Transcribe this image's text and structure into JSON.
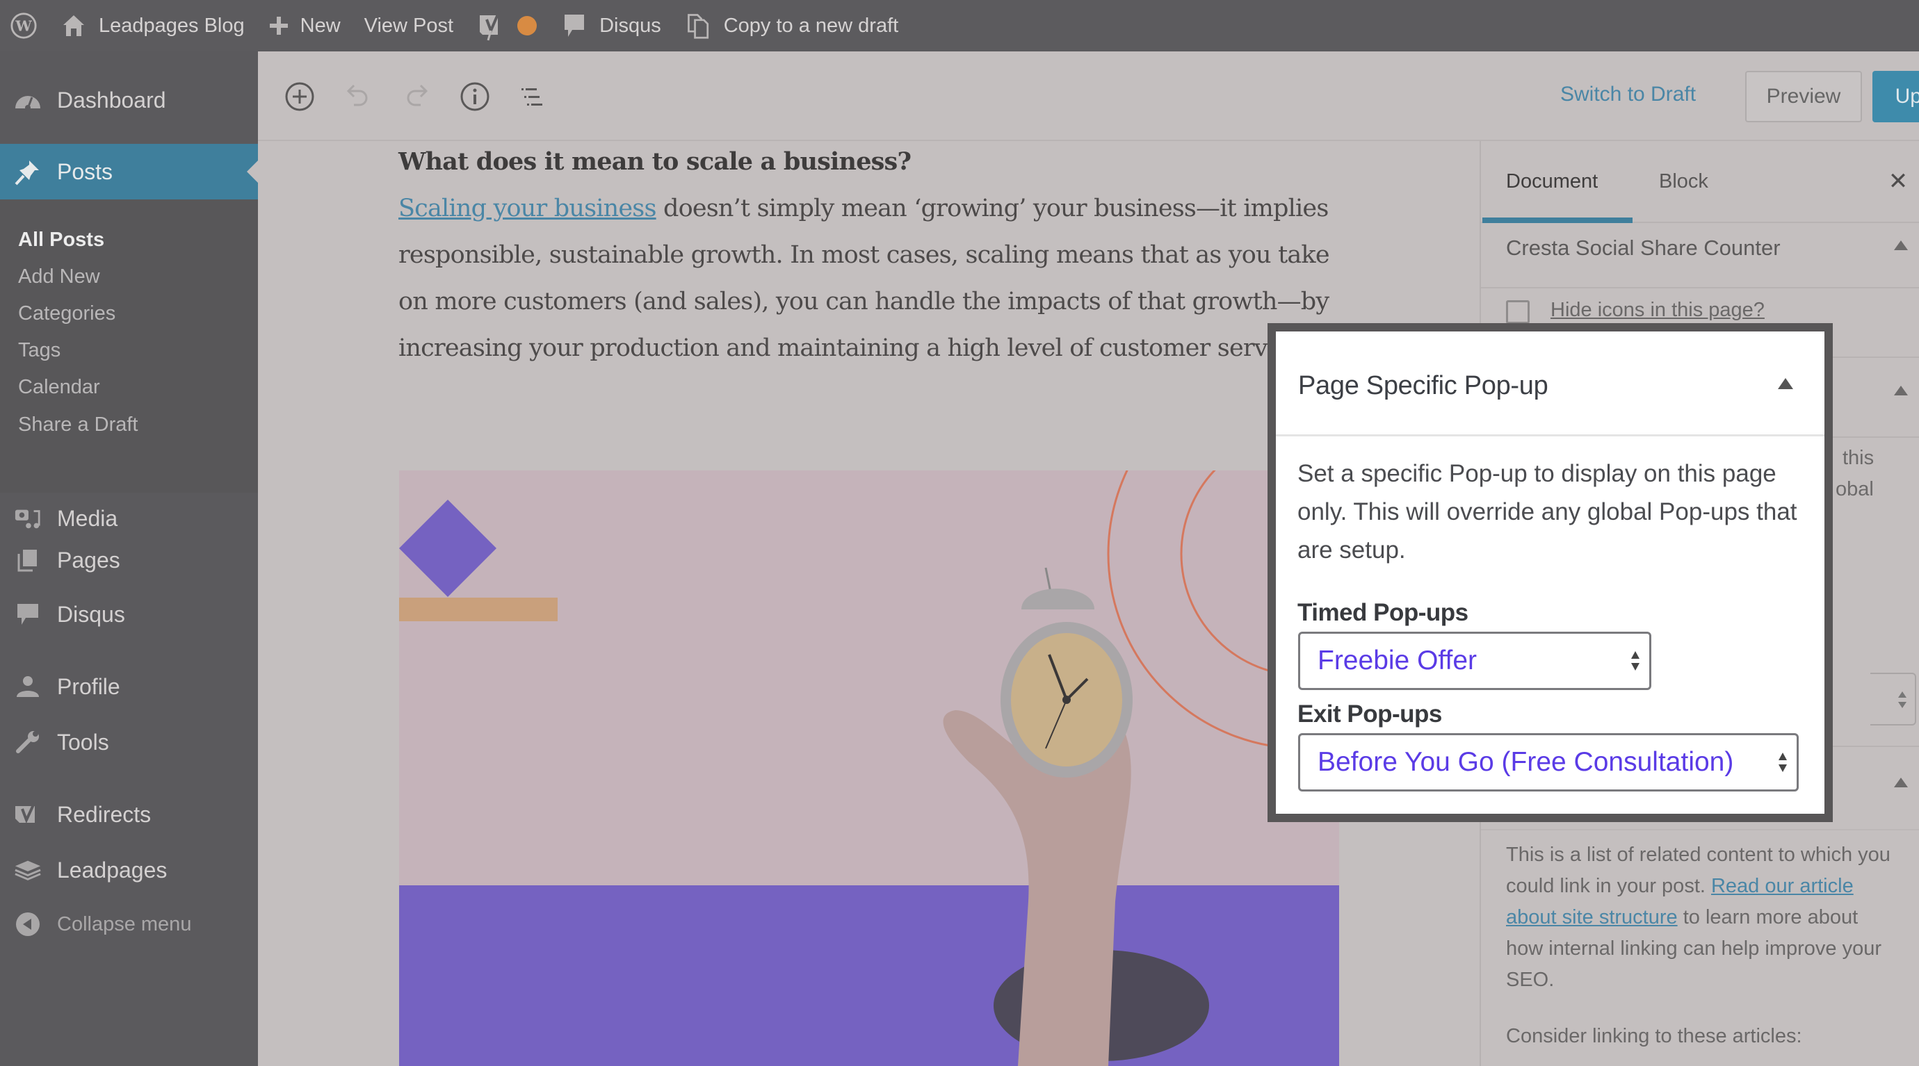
{
  "admin_bar": {
    "site_name": "Leadpages Blog",
    "new_label": "New",
    "view_post_label": "View Post",
    "disqus_label": "Disqus",
    "copy_draft_label": "Copy to a new draft",
    "icons": [
      "wordpress-logo-icon",
      "home-icon",
      "plus-icon",
      "yoast-icon",
      "status-dot-icon",
      "comment-icon",
      "copy-icon"
    ],
    "status_dot_color": "#d88b43"
  },
  "sidebar": {
    "items": [
      {
        "label": "Dashboard",
        "icon": "dashboard-icon"
      },
      {
        "label": "Posts",
        "icon": "pin-icon",
        "active": true
      },
      {
        "label": "Media",
        "icon": "media-icon"
      },
      {
        "label": "Pages",
        "icon": "pages-icon"
      },
      {
        "label": "Disqus",
        "icon": "comment-icon"
      },
      {
        "label": "Profile",
        "icon": "user-icon"
      },
      {
        "label": "Tools",
        "icon": "wrench-icon"
      },
      {
        "label": "Redirects",
        "icon": "yoast-icon"
      },
      {
        "label": "Leadpages",
        "icon": "layers-icon"
      }
    ],
    "submenu": [
      "All Posts",
      "Add New",
      "Categories",
      "Tags",
      "Calendar",
      "Share a Draft"
    ],
    "collapse_label": "Collapse menu",
    "active_color": "#3f7f9c"
  },
  "toolbar": {
    "switch_to_draft": "Switch to Draft",
    "preview": "Preview",
    "update": "Update",
    "update_color": "#3e8bab"
  },
  "content": {
    "heading": "What does it mean to scale a business?",
    "link_text": "Scaling your business",
    "paragraph": " doesn’t simply mean ‘growing’ your business—it implies responsible, sustainable growth. In most cases, scaling means that as you take on more customers (and sales), you can handle the impacts of that growth—by increasing your production and maintaining a high level of customer service."
  },
  "right_sidebar": {
    "tabs": [
      {
        "label": "Document",
        "active": true
      },
      {
        "label": "Block",
        "active": false
      }
    ],
    "cresta_title": "Cresta Social Share Counter",
    "hide_icons_label": "Hide icons in this page?",
    "hide_icons_checked": false,
    "behind_text_1": "this",
    "behind_text_2": "obal",
    "linking_text_before": "This is a list of related content to which you could link in your post. ",
    "linking_link": "Read our article about site structure",
    "linking_text_after": " to learn more about how internal linking can help improve your SEO.",
    "consider_text": "Consider linking to these articles:"
  },
  "popup": {
    "title": "Page Specific Pop-up",
    "description": "Set a specific Pop-up to display on this page only. This will override any global Pop-ups that are setup.",
    "timed_label": "Timed Pop-ups",
    "timed_value": "Freebie Offer",
    "exit_label": "Exit Pop-ups",
    "exit_value": "Before You Go (Free Consultation)",
    "select_text_color": "#5a3be6"
  }
}
